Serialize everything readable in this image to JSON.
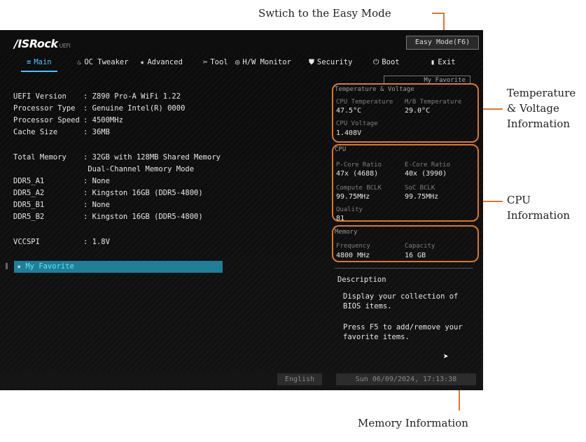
{
  "callouts": {
    "easy_mode": "Swtich to the Easy Mode",
    "temp_line1": "Temperature",
    "temp_line2": "& Voltage",
    "temp_line3": "Information",
    "cpu_line1": "CPU",
    "cpu_line2": "Information",
    "memory": "Memory Information"
  },
  "header": {
    "logo": "/ISRock",
    "logo_sub": "UEFI",
    "easy_mode_button": "Easy Mode(F6)"
  },
  "tabs": [
    {
      "label": "Main",
      "icon": "list-icon",
      "glyph": "≡"
    },
    {
      "label": "OC Tweaker",
      "icon": "flame-icon",
      "glyph": "♨"
    },
    {
      "label": "Advanced",
      "icon": "star-icon",
      "glyph": "★"
    },
    {
      "label": "Tool",
      "icon": "tool-icon",
      "glyph": "✂"
    },
    {
      "label": "H/W Monitor",
      "icon": "monitor-icon",
      "glyph": "◎"
    },
    {
      "label": "Security",
      "icon": "shield-icon",
      "glyph": "⛊"
    },
    {
      "label": "Boot",
      "icon": "power-icon",
      "glyph": "⏻"
    },
    {
      "label": "Exit",
      "icon": "exit-icon",
      "glyph": "▮"
    }
  ],
  "my_favorite_tab": "My Favorite",
  "system_info": [
    {
      "key": "UEFI Version",
      "value": ": Z890 Pro-A WiFi 1.22"
    },
    {
      "key": "Processor Type",
      "value": ": Genuine Intel(R) 0000"
    },
    {
      "key": "Processor Speed",
      "value": ": 4500MHz"
    },
    {
      "key": "Cache Size",
      "value": ": 36MB"
    },
    {
      "key": "Total Memory",
      "value": ": 32GB with 128MB Shared Memory"
    },
    {
      "key": "",
      "value": "  Dual-Channel Memory Mode"
    },
    {
      "key": "DDR5_A1",
      "value": ": None"
    },
    {
      "key": "DDR5_A2",
      "value": ": Kingston 16GB (DDR5-4800)"
    },
    {
      "key": "DDR5_B1",
      "value": ": None"
    },
    {
      "key": "DDR5_B2",
      "value": ": Kingston 16GB (DDR5-4800)"
    },
    {
      "key": "VCCSPI",
      "value": ": 1.8V"
    }
  ],
  "favorite_item": "My Favorite",
  "temp_panel": {
    "title": "Temperature & Voltage",
    "cpu_temp_label": "CPU Temperature",
    "cpu_temp_value": "47.5°C",
    "mb_temp_label": "M/B Temperature",
    "mb_temp_value": "29.0°C",
    "cpu_voltage_label": "CPU Voltage",
    "cpu_voltage_value": "1.408V"
  },
  "cpu_panel": {
    "title": "CPU",
    "pcore_label": "P-Core Ratio",
    "pcore_value": "47x (4688)",
    "ecore_label": "E-Core Ratio",
    "ecore_value": "40x (3990)",
    "compute_bclk_label": "Compute BCLK",
    "compute_bclk_value": "99.75MHz",
    "soc_bclk_label": "SoC BCLK",
    "soc_bclk_value": "99.75MHz",
    "quality_label": "Quality",
    "quality_value": "81"
  },
  "memory_panel": {
    "title": "Memory",
    "freq_label": "Frequency",
    "freq_value": "4800 MHz",
    "cap_label": "Capacity",
    "cap_value": "16 GB"
  },
  "description": {
    "title": "Description",
    "line1": "Display your collection of BIOS items.",
    "line2": "Press F5 to add/remove your favorite items."
  },
  "footer": {
    "language": "English",
    "datetime": "Sun 06/09/2024, 17:13:38"
  },
  "colors": {
    "accent": "#4fc3f7",
    "callout": "#d9782e",
    "favorite_bar": "#1f7f97"
  }
}
